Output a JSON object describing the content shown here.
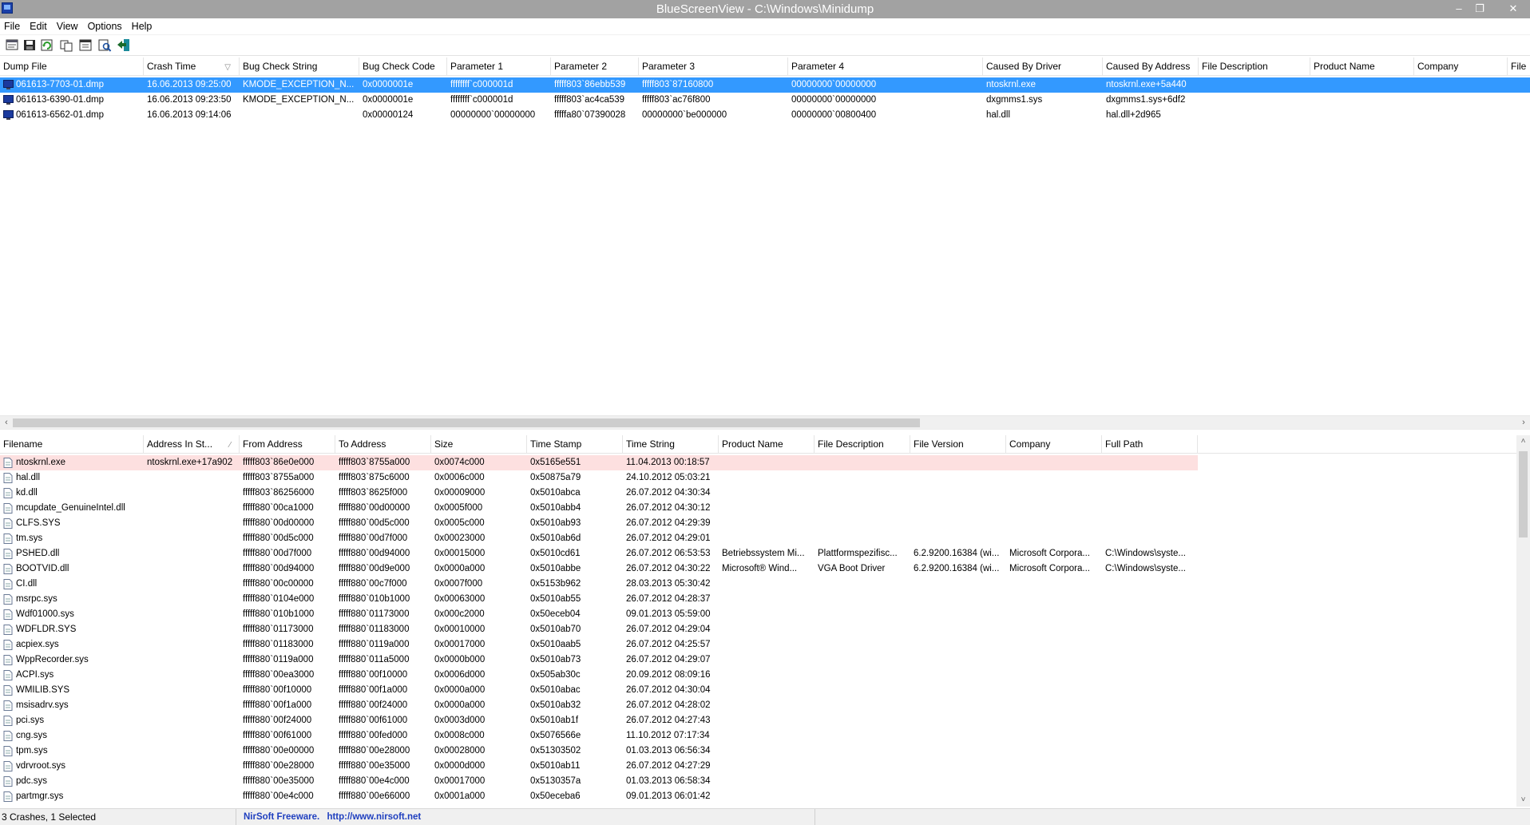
{
  "window": {
    "title": "BlueScreenView  -  C:\\Windows\\Minidump",
    "minimize": "–",
    "restore": "❐",
    "close": "✕"
  },
  "menu": [
    "File",
    "Edit",
    "View",
    "Options",
    "Help"
  ],
  "toolbar_icons": [
    "html-report-icon",
    "save-icon",
    "refresh-icon",
    "copy-icon",
    "properties-icon",
    "find-icon",
    "exit-icon"
  ],
  "crash_list": {
    "columns": [
      "Dump File",
      "Crash Time",
      "Bug Check String",
      "Bug Check Code",
      "Parameter 1",
      "Parameter 2",
      "Parameter 3",
      "Parameter 4",
      "Caused By Driver",
      "Caused By Address",
      "File Description",
      "Product Name",
      "Company",
      "File"
    ],
    "rows": [
      [
        "061613-7703-01.dmp",
        "16.06.2013 09:25:00",
        "KMODE_EXCEPTION_N...",
        "0x0000001e",
        "ffffffff`c000001d",
        "fffff803`86ebb539",
        "fffff803`87160800",
        "00000000`00000000",
        "ntoskrnl.exe",
        "ntoskrnl.exe+5a440"
      ],
      [
        "061613-6390-01.dmp",
        "16.06.2013 09:23:50",
        "KMODE_EXCEPTION_N...",
        "0x0000001e",
        "ffffffff`c000001d",
        "fffff803`ac4ca539",
        "fffff803`ac76f800",
        "00000000`00000000",
        "dxgmms1.sys",
        "dxgmms1.sys+6df2"
      ],
      [
        "061613-6562-01.dmp",
        "16.06.2013 09:14:06",
        "",
        "0x00000124",
        "00000000`00000000",
        "fffffa80`07390028",
        "00000000`be000000",
        "00000000`00800400",
        "hal.dll",
        "hal.dll+2d965"
      ]
    ]
  },
  "driver_list": {
    "columns": [
      "Filename",
      "Address In St...",
      "From Address",
      "To Address",
      "Size",
      "Time Stamp",
      "Time String",
      "Product Name",
      "File Description",
      "File Version",
      "Company",
      "Full Path"
    ],
    "rows": [
      [
        "ntoskrnl.exe",
        "ntoskrnl.exe+17a902",
        "fffff803`86e0e000",
        "fffff803`8755a000",
        "0x0074c000",
        "0x5165e551",
        "11.04.2013 00:18:57",
        "",
        "",
        "",
        "",
        ""
      ],
      [
        "hal.dll",
        "",
        "fffff803`8755a000",
        "fffff803`875c6000",
        "0x0006c000",
        "0x50875a79",
        "24.10.2012 05:03:21",
        "",
        "",
        "",
        "",
        ""
      ],
      [
        "kd.dll",
        "",
        "fffff803`86256000",
        "fffff803`8625f000",
        "0x00009000",
        "0x5010abca",
        "26.07.2012 04:30:34",
        "",
        "",
        "",
        "",
        ""
      ],
      [
        "mcupdate_GenuineIntel.dll",
        "",
        "fffff880`00ca1000",
        "fffff880`00d00000",
        "0x0005f000",
        "0x5010abb4",
        "26.07.2012 04:30:12",
        "",
        "",
        "",
        "",
        ""
      ],
      [
        "CLFS.SYS",
        "",
        "fffff880`00d00000",
        "fffff880`00d5c000",
        "0x0005c000",
        "0x5010ab93",
        "26.07.2012 04:29:39",
        "",
        "",
        "",
        "",
        ""
      ],
      [
        "tm.sys",
        "",
        "fffff880`00d5c000",
        "fffff880`00d7f000",
        "0x00023000",
        "0x5010ab6d",
        "26.07.2012 04:29:01",
        "",
        "",
        "",
        "",
        ""
      ],
      [
        "PSHED.dll",
        "",
        "fffff880`00d7f000",
        "fffff880`00d94000",
        "0x00015000",
        "0x5010cd61",
        "26.07.2012 06:53:53",
        "Betriebssystem Mi...",
        "Plattformspezifisc...",
        "6.2.9200.16384 (wi...",
        "Microsoft Corpora...",
        "C:\\Windows\\syste..."
      ],
      [
        "BOOTVID.dll",
        "",
        "fffff880`00d94000",
        "fffff880`00d9e000",
        "0x0000a000",
        "0x5010abbe",
        "26.07.2012 04:30:22",
        "Microsoft® Wind...",
        "VGA Boot Driver",
        "6.2.9200.16384 (wi...",
        "Microsoft Corpora...",
        "C:\\Windows\\syste..."
      ],
      [
        "CI.dll",
        "",
        "fffff880`00c00000",
        "fffff880`00c7f000",
        "0x0007f000",
        "0x5153b962",
        "28.03.2013 05:30:42",
        "",
        "",
        "",
        "",
        ""
      ],
      [
        "msrpc.sys",
        "",
        "fffff880`0104e000",
        "fffff880`010b1000",
        "0x00063000",
        "0x5010ab55",
        "26.07.2012 04:28:37",
        "",
        "",
        "",
        "",
        ""
      ],
      [
        "Wdf01000.sys",
        "",
        "fffff880`010b1000",
        "fffff880`01173000",
        "0x000c2000",
        "0x50eceb04",
        "09.01.2013 05:59:00",
        "",
        "",
        "",
        "",
        ""
      ],
      [
        "WDFLDR.SYS",
        "",
        "fffff880`01173000",
        "fffff880`01183000",
        "0x00010000",
        "0x5010ab70",
        "26.07.2012 04:29:04",
        "",
        "",
        "",
        "",
        ""
      ],
      [
        "acpiex.sys",
        "",
        "fffff880`01183000",
        "fffff880`0119a000",
        "0x00017000",
        "0x5010aab5",
        "26.07.2012 04:25:57",
        "",
        "",
        "",
        "",
        ""
      ],
      [
        "WppRecorder.sys",
        "",
        "fffff880`0119a000",
        "fffff880`011a5000",
        "0x0000b000",
        "0x5010ab73",
        "26.07.2012 04:29:07",
        "",
        "",
        "",
        "",
        ""
      ],
      [
        "ACPI.sys",
        "",
        "fffff880`00ea3000",
        "fffff880`00f10000",
        "0x0006d000",
        "0x505ab30c",
        "20.09.2012 08:09:16",
        "",
        "",
        "",
        "",
        ""
      ],
      [
        "WMILIB.SYS",
        "",
        "fffff880`00f10000",
        "fffff880`00f1a000",
        "0x0000a000",
        "0x5010abac",
        "26.07.2012 04:30:04",
        "",
        "",
        "",
        "",
        ""
      ],
      [
        "msisadrv.sys",
        "",
        "fffff880`00f1a000",
        "fffff880`00f24000",
        "0x0000a000",
        "0x5010ab32",
        "26.07.2012 04:28:02",
        "",
        "",
        "",
        "",
        ""
      ],
      [
        "pci.sys",
        "",
        "fffff880`00f24000",
        "fffff880`00f61000",
        "0x0003d000",
        "0x5010ab1f",
        "26.07.2012 04:27:43",
        "",
        "",
        "",
        "",
        ""
      ],
      [
        "cng.sys",
        "",
        "fffff880`00f61000",
        "fffff880`00fed000",
        "0x0008c000",
        "0x5076566e",
        "11.10.2012 07:17:34",
        "",
        "",
        "",
        "",
        ""
      ],
      [
        "tpm.sys",
        "",
        "fffff880`00e00000",
        "fffff880`00e28000",
        "0x00028000",
        "0x51303502",
        "01.03.2013 06:56:34",
        "",
        "",
        "",
        "",
        ""
      ],
      [
        "vdrvroot.sys",
        "",
        "fffff880`00e28000",
        "fffff880`00e35000",
        "0x0000d000",
        "0x5010ab11",
        "26.07.2012 04:27:29",
        "",
        "",
        "",
        "",
        ""
      ],
      [
        "pdc.sys",
        "",
        "fffff880`00e35000",
        "fffff880`00e4c000",
        "0x00017000",
        "0x5130357a",
        "01.03.2013 06:58:34",
        "",
        "",
        "",
        "",
        ""
      ],
      [
        "partmgr.sys",
        "",
        "fffff880`00e4c000",
        "fffff880`00e66000",
        "0x0001a000",
        "0x50eceba6",
        "09.01.2013 06:01:42",
        "",
        "",
        "",
        "",
        ""
      ]
    ]
  },
  "status": {
    "summary": "3 Crashes, 1 Selected",
    "freeware": "NirSoft Freeware.",
    "url": "http://www.nirsoft.net"
  },
  "colors": {
    "selection": "#3399ff",
    "highlight_row": "#fde0e0",
    "title_bar": "#a2a2a2",
    "status_link": "#1f3fbf"
  }
}
